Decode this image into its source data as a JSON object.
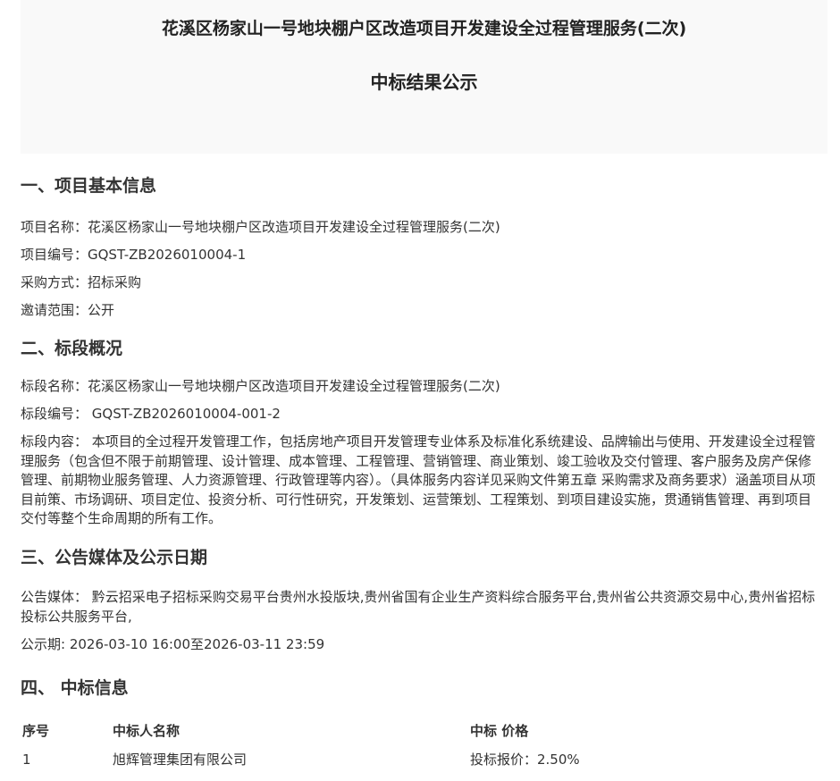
{
  "header": {
    "title": "花溪区杨家山一号地块棚户区改造项目开发建设全过程管理服务(二次)",
    "subtitle": "中标结果公示"
  },
  "section1": {
    "heading": "一、项目基本信息",
    "project_name": "项目名称：花溪区杨家山一号地块棚户区改造项目开发建设全过程管理服务(二次)",
    "project_code": "项目编号：GQST-ZB2026010004-1",
    "procurement_method": "采购方式：招标采购",
    "invitation_scope": "邀请范围：公开"
  },
  "section2": {
    "heading": "二、标段概况",
    "lot_name": "标段名称：花溪区杨家山一号地块棚户区改造项目开发建设全过程管理服务(二次)",
    "lot_code": "标段编号： GQST-ZB2026010004-001-2",
    "lot_content": "标段内容： 本项目的全过程开发管理工作，包括房地产项目开发管理专业体系及标准化系统建设、品牌输出与使用、开发建设全过程管理服务（包含但不限于前期管理、设计管理、成本管理、工程管理、营销管理、商业策划、竣工验收及交付管理、客户服务及房产保修管理、前期物业服务管理、人力资源管理、行政管理等内容）。（具体服务内容详见采购文件第五章 采购需求及商务要求）涵盖项目从项目前策、市场调研、项目定位、投资分析、可行性研究，开发策划、运营策划、工程策划、到项目建设实施，贯通销售管理、再到项目交付等整个生命周期的所有工作。"
  },
  "section3": {
    "heading": "三、公告媒体及公示日期",
    "media": "公告媒体： 黔云招采电子招标采购交易平台贵州水投版块,贵州省国有企业生产资料综合服务平台,贵州省公共资源交易中心,贵州省招标投标公共服务平台,",
    "period": "公示期: 2026-03-10 16:00至2026-03-11 23:59"
  },
  "section4": {
    "heading": "四、 中标信息",
    "table": {
      "headers": [
        "序号",
        "中标人名称",
        "中标 价格"
      ],
      "rows": [
        [
          "1",
          "旭辉管理集团有限公司",
          "投标报价：2.50%"
        ]
      ]
    }
  }
}
